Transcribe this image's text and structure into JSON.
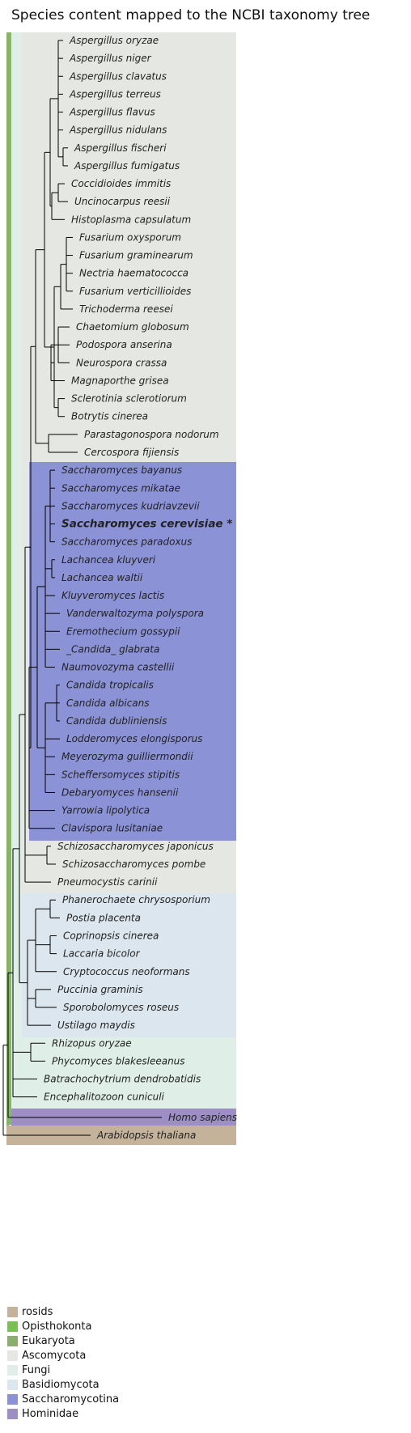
{
  "title": "Species content mapped to the NCBI taxonomy tree",
  "colors": {
    "rosids": "#c4b39a",
    "Opisthokonta": "#79c152",
    "Eukaryota": "#8cae6c",
    "Ascomycota": "#e5e8e2",
    "Fungi": "#dfefe7",
    "Basidiomycota": "#dce6ee",
    "Saccharomycotina": "#8b92d5",
    "Hominidae": "#9d8fc6",
    "branch": "#000000"
  },
  "species": [
    {
      "label": "Aspergillus oryzae"
    },
    {
      "label": "Aspergillus niger"
    },
    {
      "label": "Aspergillus clavatus"
    },
    {
      "label": "Aspergillus terreus"
    },
    {
      "label": "Aspergillus flavus"
    },
    {
      "label": "Aspergillus nidulans"
    },
    {
      "label": "Aspergillus fischeri"
    },
    {
      "label": "Aspergillus fumigatus"
    },
    {
      "label": "Coccidioides immitis"
    },
    {
      "label": "Uncinocarpus reesii"
    },
    {
      "label": "Histoplasma capsulatum"
    },
    {
      "label": "Fusarium oxysporum"
    },
    {
      "label": "Fusarium graminearum"
    },
    {
      "label": "Nectria haematococca"
    },
    {
      "label": "Fusarium verticillioides"
    },
    {
      "label": "Trichoderma reesei"
    },
    {
      "label": "Chaetomium globosum"
    },
    {
      "label": "Podospora anserina"
    },
    {
      "label": "Neurospora crassa"
    },
    {
      "label": "Magnaporthe grisea"
    },
    {
      "label": "Sclerotinia sclerotiorum"
    },
    {
      "label": "Botrytis cinerea"
    },
    {
      "label": "Parastagonospora nodorum"
    },
    {
      "label": "Cercospora fijiensis"
    },
    {
      "label": "Saccharomyces bayanus"
    },
    {
      "label": "Saccharomyces mikatae"
    },
    {
      "label": "Saccharomyces kudriavzevii"
    },
    {
      "label": "Saccharomyces cerevisiae *",
      "highlight": true
    },
    {
      "label": "Saccharomyces paradoxus"
    },
    {
      "label": "Lachancea kluyveri"
    },
    {
      "label": "Lachancea waltii"
    },
    {
      "label": "Kluyveromyces lactis"
    },
    {
      "label": "Vanderwaltozyma polyspora"
    },
    {
      "label": "Eremothecium gossypii"
    },
    {
      "label": "_Candida_ glabrata"
    },
    {
      "label": "Naumovozyma castellii"
    },
    {
      "label": "Candida tropicalis"
    },
    {
      "label": "Candida albicans"
    },
    {
      "label": "Candida dubliniensis"
    },
    {
      "label": "Lodderomyces elongisporus"
    },
    {
      "label": "Meyerozyma guilliermondii"
    },
    {
      "label": "Scheffersomyces stipitis"
    },
    {
      "label": "Debaryomyces hansenii"
    },
    {
      "label": "Yarrowia lipolytica"
    },
    {
      "label": "Clavispora lusitaniae"
    },
    {
      "label": "Schizosaccharomyces japonicus"
    },
    {
      "label": "Schizosaccharomyces pombe"
    },
    {
      "label": "Pneumocystis carinii"
    },
    {
      "label": "Phanerochaete chrysosporium"
    },
    {
      "label": "Postia placenta"
    },
    {
      "label": "Coprinopsis cinerea"
    },
    {
      "label": "Laccaria bicolor"
    },
    {
      "label": "Cryptococcus neoformans"
    },
    {
      "label": "Puccinia graminis"
    },
    {
      "label": "Sporobolomyces roseus"
    },
    {
      "label": "Ustilago maydis"
    },
    {
      "label": "Rhizopus oryzae"
    },
    {
      "label": "Phycomyces blakesleeanus"
    },
    {
      "label": "Batrachochytrium dendrobatidis"
    },
    {
      "label": "Encephalitozoon cuniculi"
    },
    {
      "label": "Homo sapiens"
    },
    {
      "label": "Arabidopsis thaliana"
    }
  ],
  "legend": [
    {
      "label": "rosids",
      "color": "#c4b39a"
    },
    {
      "label": "Opisthokonta",
      "color": "#79c152"
    },
    {
      "label": "Eukaryota",
      "color": "#8cae6c"
    },
    {
      "label": "Ascomycota",
      "color": "#e5e8e2"
    },
    {
      "label": "Fungi",
      "color": "#dfefe7"
    },
    {
      "label": "Basidiomycota",
      "color": "#dce6ee"
    },
    {
      "label": "Saccharomycotina",
      "color": "#8b92d5"
    },
    {
      "label": "Hominidae",
      "color": "#9d8fc6"
    }
  ]
}
